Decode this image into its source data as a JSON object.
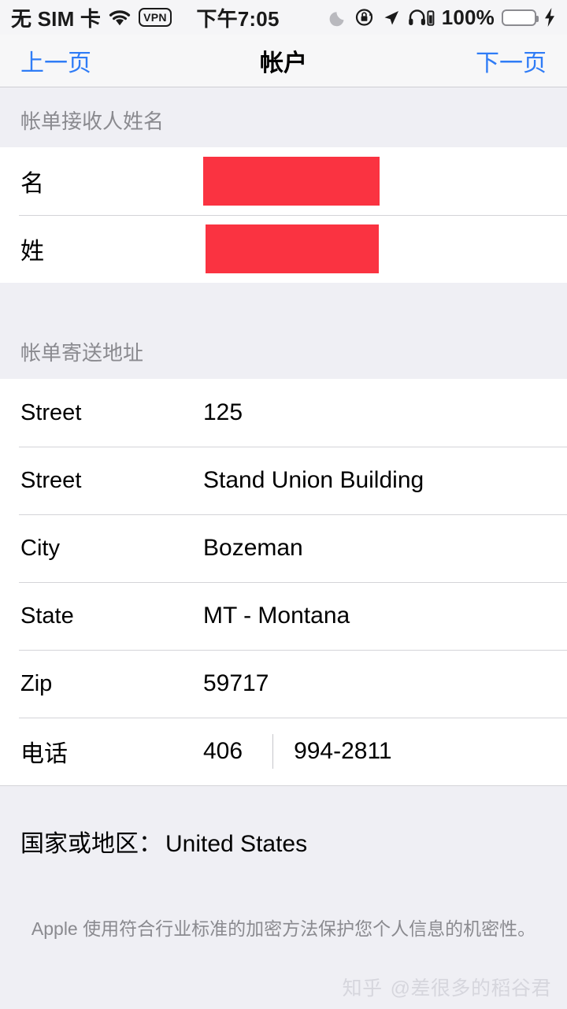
{
  "status_bar": {
    "carrier": "无 SIM 卡",
    "wifi_icon": "wifi-icon",
    "vpn_label": "VPN",
    "time": "下午7:05",
    "moon_icon": "do-not-disturb-moon-icon",
    "rotation_lock_icon": "rotation-lock-icon",
    "location_icon": "location-arrow-icon",
    "headphones_icon": "headphones-battery-icon",
    "battery_percent": "100%",
    "battery_icon": "battery-icon",
    "charging_icon": "lightning-bolt-icon",
    "battery_color": "#4CD964"
  },
  "nav": {
    "back_label": "上一页",
    "title": "帐户",
    "next_label": "下一页",
    "link_color": "#2F7CF6"
  },
  "sections": [
    {
      "header": "帐单接收人姓名",
      "rows": [
        {
          "label": "名",
          "value": "",
          "redacted": true
        },
        {
          "label": "姓",
          "value": "",
          "redacted": true
        }
      ]
    },
    {
      "header": "帐单寄送地址",
      "rows": [
        {
          "label": "Street",
          "value": "125"
        },
        {
          "label": "Street",
          "value": "Stand Union Building"
        },
        {
          "label": "City",
          "value": "Bozeman"
        },
        {
          "label": "State",
          "value": "MT - Montana"
        },
        {
          "label": "Zip",
          "value": "59717"
        }
      ],
      "phone_row": {
        "label": "电话",
        "area_code": "406",
        "number": "994-2811"
      }
    }
  ],
  "country": {
    "label": "国家或地区：",
    "value": "United States"
  },
  "footer": {
    "note": "Apple 使用符合行业标准的加密方法保护您个人信息的机密性。"
  },
  "watermark": {
    "site": "知乎",
    "handle": "@差很多的稻谷君"
  },
  "colors": {
    "redaction": "#FA3341",
    "group_background": "#EFEFF4",
    "row_background": "#FFFFFF",
    "secondary_text": "#8A8A8F"
  }
}
